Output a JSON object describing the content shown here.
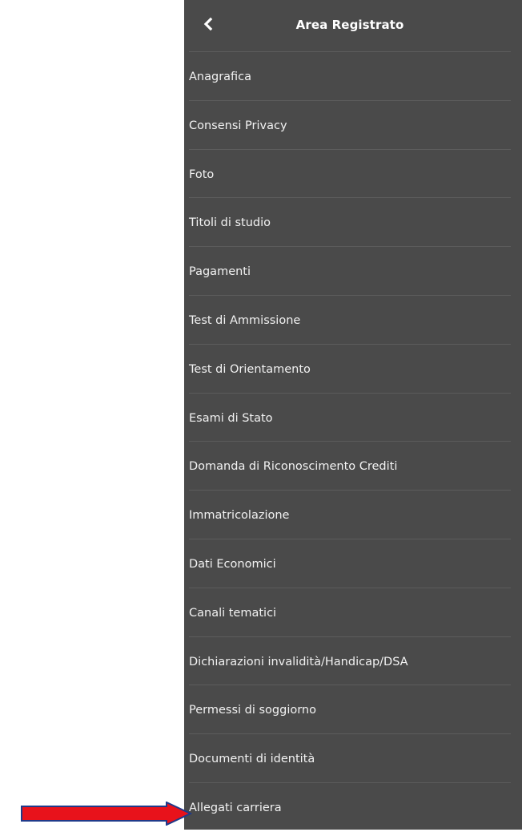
{
  "header": {
    "title": "Area Registrato",
    "back_icon": "chevron-left-icon"
  },
  "menu": {
    "items": [
      {
        "label": "Anagrafica"
      },
      {
        "label": "Consensi Privacy"
      },
      {
        "label": "Foto"
      },
      {
        "label": "Titoli di studio"
      },
      {
        "label": "Pagamenti"
      },
      {
        "label": "Test di Ammissione"
      },
      {
        "label": "Test di Orientamento"
      },
      {
        "label": "Esami di Stato"
      },
      {
        "label": "Domanda di Riconoscimento Crediti"
      },
      {
        "label": "Immatricolazione"
      },
      {
        "label": "Dati Economici"
      },
      {
        "label": "Canali tematici"
      },
      {
        "label": "Dichiarazioni invalidità/Handicap/DSA"
      },
      {
        "label": "Permessi di soggiorno"
      },
      {
        "label": "Documenti di identità"
      },
      {
        "label": "Allegati carriera"
      }
    ]
  },
  "annotation": {
    "arrow_icon": "red-arrow-right-icon",
    "arrow_fill": "#e8121b",
    "arrow_stroke": "#1f3a8a"
  },
  "colors": {
    "panel_background": "#4a4a4a",
    "divider": "#5c5c5c",
    "text": "#f2f2f2"
  }
}
